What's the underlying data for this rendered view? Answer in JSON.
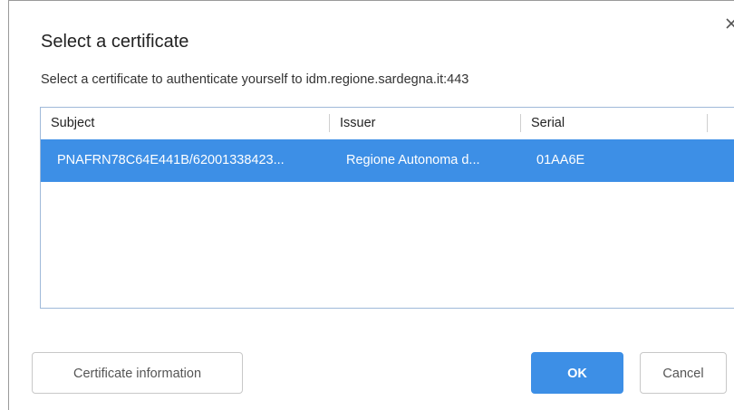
{
  "dialog": {
    "title": "Select a certificate",
    "subtitle": "Select a certificate to authenticate yourself to idm.regione.sardegna.it:443",
    "close_icon": "close-icon"
  },
  "table": {
    "columns": [
      "Subject",
      "Issuer",
      "Serial"
    ],
    "rows": [
      {
        "subject": "PNAFRN78C64E441B/62001338423...",
        "issuer": "Regione Autonoma d...",
        "serial": "01AA6E",
        "selected": true
      }
    ]
  },
  "buttons": {
    "info": "Certificate information",
    "ok": "OK",
    "cancel": "Cancel"
  },
  "colors": {
    "accent": "#3d8fe6",
    "selection": "#3d8fe6"
  }
}
